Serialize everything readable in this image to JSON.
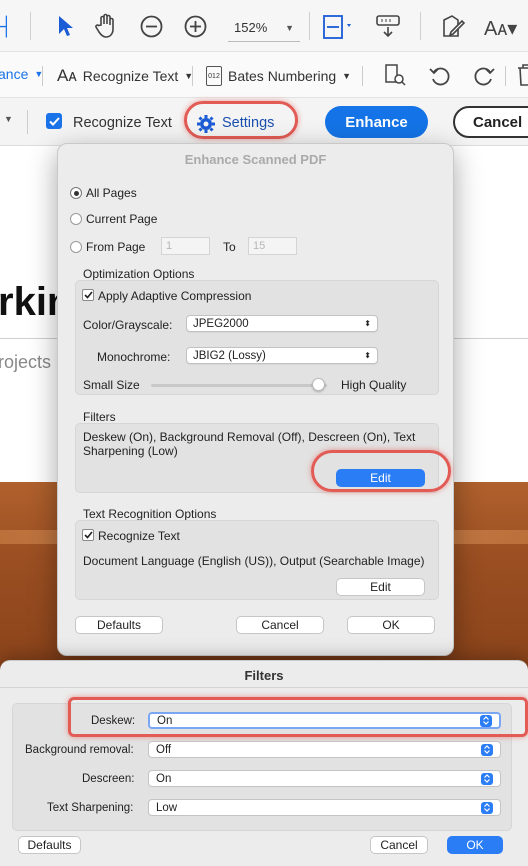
{
  "toolbar": {
    "zoom_value": "152%"
  },
  "toolbar2": {
    "enhance_label": "ance",
    "recognize_text_label": "Recognize Text",
    "bates_numbering_label": "Bates Numbering"
  },
  "action_bar": {
    "recognize_text_label": "Recognize Text",
    "settings_label": "Settings",
    "enhance_label": "Enhance",
    "cancel_label": "Cancel"
  },
  "document": {
    "heading_fragment": "rkin",
    "subtitle_fragment": "rojects"
  },
  "enhance_dialog": {
    "title": "Enhance Scanned PDF",
    "all_pages": "All Pages",
    "current_page": "Current Page",
    "from_page": "From Page",
    "from_value": "1",
    "to_label": "To",
    "to_value": "15",
    "optimization_title": "Optimization Options",
    "adaptive_compression": "Apply Adaptive Compression",
    "color_label": "Color/Grayscale:",
    "color_value": "JPEG2000",
    "mono_label": "Monochrome:",
    "mono_value": "JBIG2 (Lossy)",
    "small_size": "Small Size",
    "high_quality": "High Quality",
    "quality_level": 0.95,
    "filters_title": "Filters",
    "filters_summary": "Deskew (On), Background Removal (Off), Descreen (On), Text Sharpening (Low)",
    "filters_edit": "Edit",
    "text_recog_title": "Text Recognition Options",
    "recognize_text": "Recognize Text",
    "text_recog_summary": "Document Language (English (US)), Output (Searchable Image)",
    "text_recog_edit": "Edit",
    "defaults": "Defaults",
    "cancel": "Cancel",
    "ok": "OK"
  },
  "filters_dialog": {
    "title": "Filters",
    "deskew_label": "Deskew:",
    "deskew_value": "On",
    "background_label": "Background removal:",
    "background_value": "Off",
    "descreen_label": "Descreen:",
    "descreen_value": "On",
    "sharpen_label": "Text Sharpening:",
    "sharpen_value": "Low",
    "defaults": "Defaults",
    "cancel": "Cancel",
    "ok": "OK"
  },
  "colors": {
    "accent": "#1473e6",
    "highlight": "#e25b55"
  }
}
